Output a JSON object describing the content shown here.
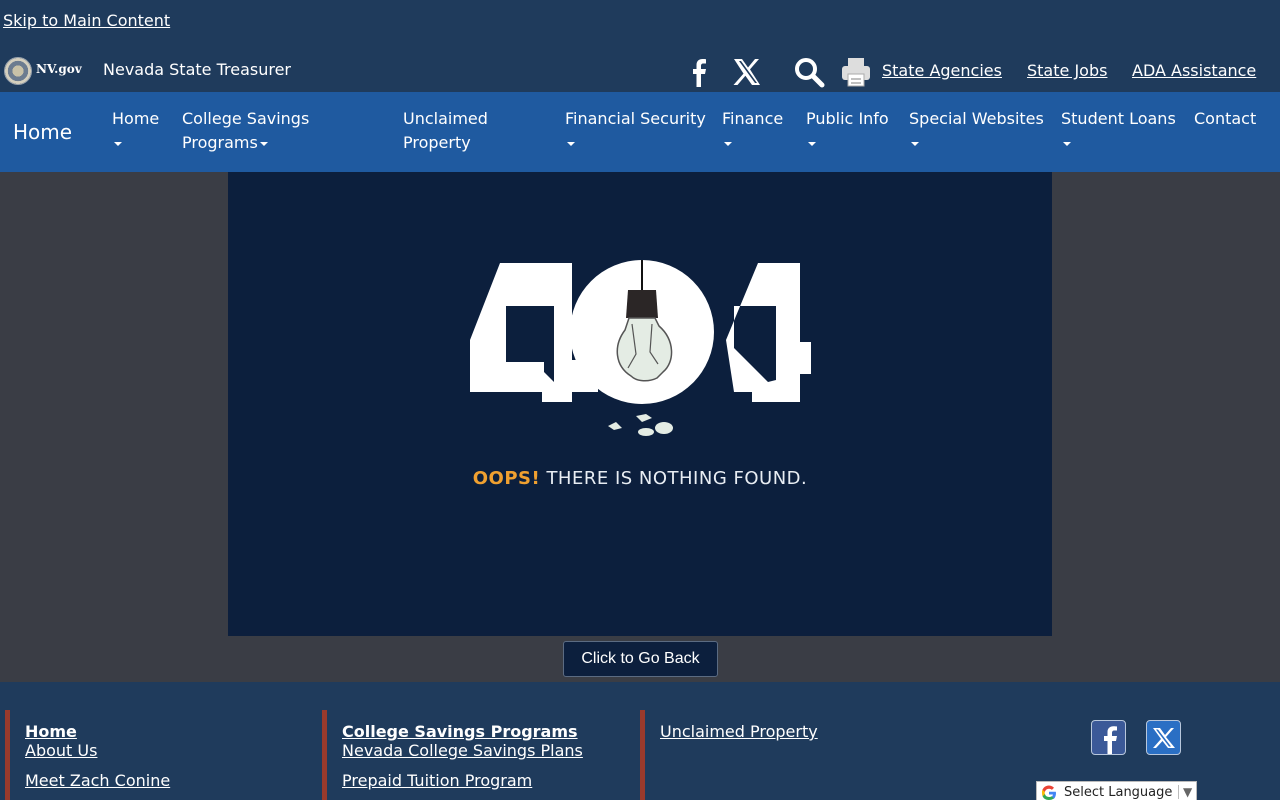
{
  "header": {
    "skip_link": "Skip to Main Content",
    "logo_text": "NV.gov",
    "site_title": "Nevada State Treasurer",
    "links": [
      "State Agencies",
      "State Jobs",
      "ADA Assistance"
    ]
  },
  "nav": {
    "home_label": "Home",
    "items": [
      {
        "label": "Home",
        "has_dropdown": true
      },
      {
        "label": "College Savings Programs",
        "has_dropdown": true
      },
      {
        "label": "Unclaimed Property",
        "has_dropdown": false
      },
      {
        "label": "Financial Security",
        "has_dropdown": true
      },
      {
        "label": "Finance",
        "has_dropdown": true
      },
      {
        "label": "Public Info",
        "has_dropdown": true
      },
      {
        "label": "Special Websites",
        "has_dropdown": true
      },
      {
        "label": "Student Loans",
        "has_dropdown": true
      },
      {
        "label": "Contact",
        "has_dropdown": false
      }
    ]
  },
  "error": {
    "code": "404",
    "oops": "OOPS!",
    "message": "THERE IS NOTHING FOUND."
  },
  "back_button": "Click to Go Back",
  "footer": {
    "columns": [
      {
        "heading": "Home",
        "links": [
          "About Us",
          "Meet Zach Conine"
        ]
      },
      {
        "heading": "College Savings Programs",
        "links": [
          "Nevada College Savings Plans",
          "Prepaid Tuition Program"
        ]
      },
      {
        "heading": "",
        "links": [
          "Unclaimed Property"
        ]
      }
    ],
    "language_select": "Select Language"
  },
  "icons": [
    "facebook-icon",
    "x-twitter-icon",
    "search-icon",
    "print-icon",
    "lightbulb-icon",
    "google-icon"
  ],
  "colors": {
    "header_bg": "#1f3b5c",
    "nav_bg": "#1f5aa0",
    "stage_bg": "#0c1f3d",
    "accent": "#f0a030",
    "footer_rule": "#9a3a2c"
  }
}
